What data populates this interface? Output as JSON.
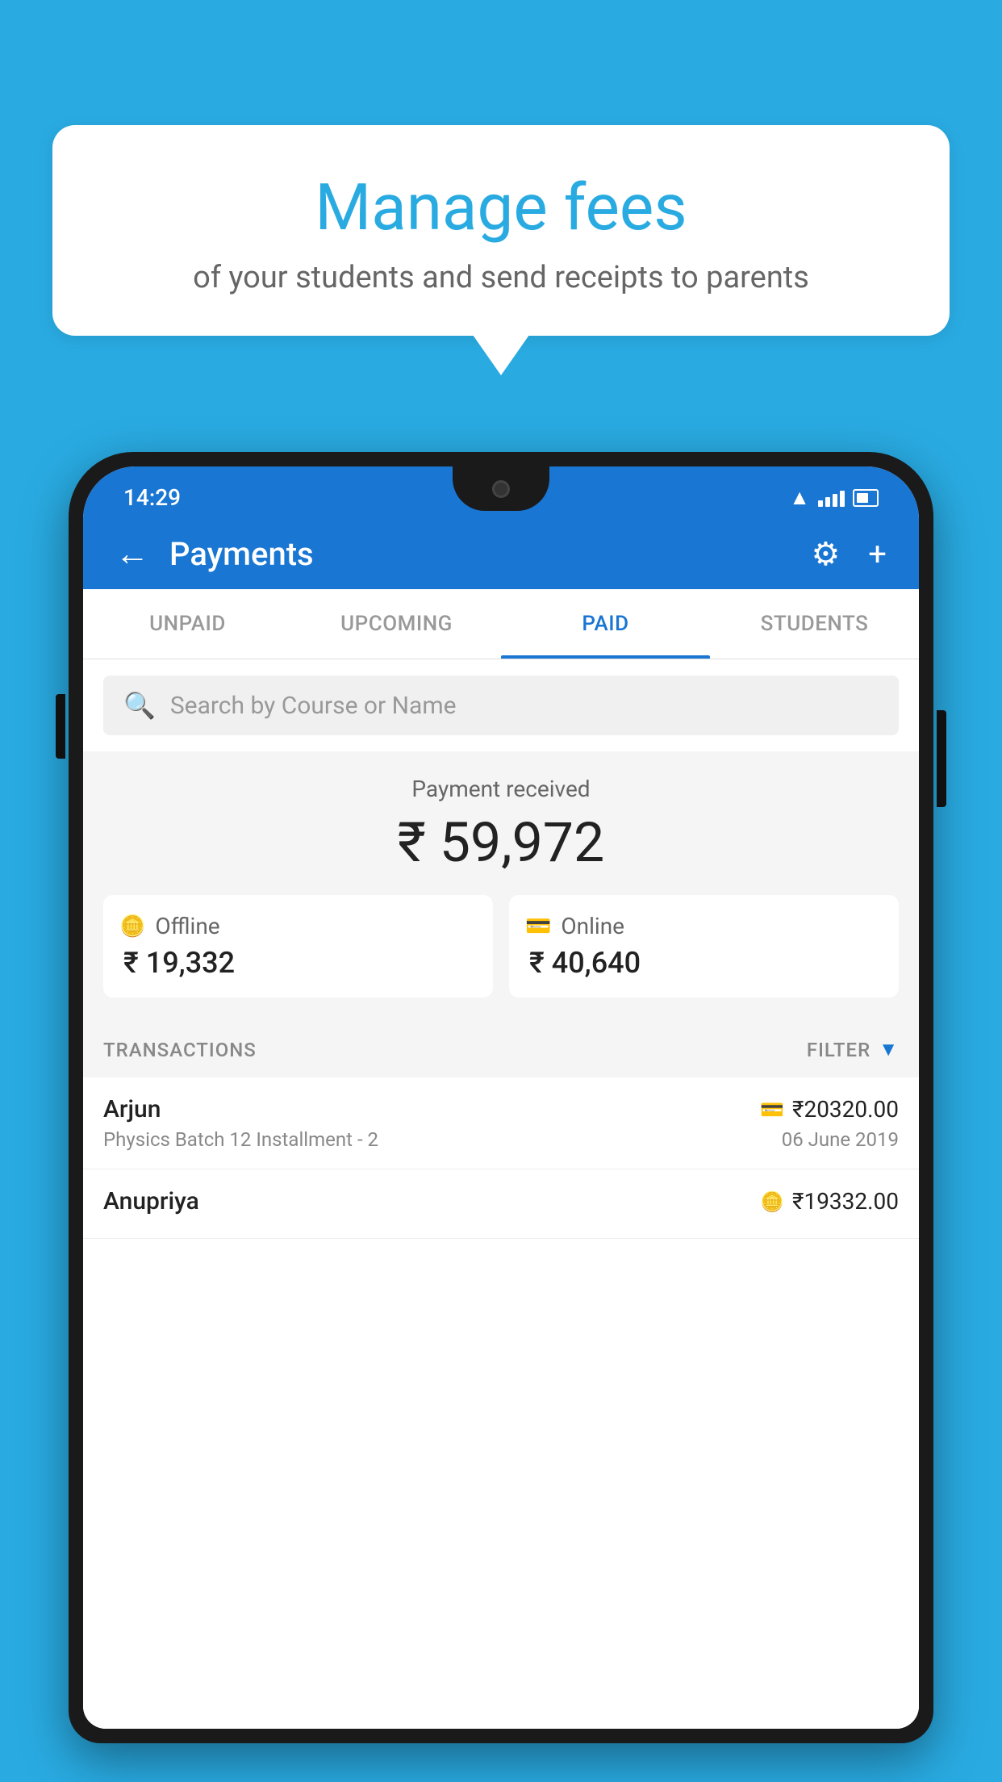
{
  "background_color": "#29ABE2",
  "bubble": {
    "title": "Manage fees",
    "subtitle": "of your students and send receipts to parents"
  },
  "status_bar": {
    "time": "14:29"
  },
  "app_bar": {
    "title": "Payments",
    "back_label": "←",
    "settings_label": "⚙",
    "add_label": "+"
  },
  "tabs": [
    {
      "label": "UNPAID",
      "active": false
    },
    {
      "label": "UPCOMING",
      "active": false
    },
    {
      "label": "PAID",
      "active": true
    },
    {
      "label": "STUDENTS",
      "active": false
    }
  ],
  "search": {
    "placeholder": "Search by Course or Name"
  },
  "payment": {
    "label": "Payment received",
    "amount": "₹ 59,972",
    "offline_label": "Offline",
    "offline_amount": "₹ 19,332",
    "online_label": "Online",
    "online_amount": "₹ 40,640"
  },
  "transactions": {
    "section_label": "TRANSACTIONS",
    "filter_label": "FILTER",
    "items": [
      {
        "name": "Arjun",
        "detail": "Physics Batch 12 Installment - 2",
        "amount": "₹20320.00",
        "date": "06 June 2019",
        "payment_type": "card"
      },
      {
        "name": "Anupriya",
        "detail": "",
        "amount": "₹19332.00",
        "date": "",
        "payment_type": "offline"
      }
    ]
  }
}
